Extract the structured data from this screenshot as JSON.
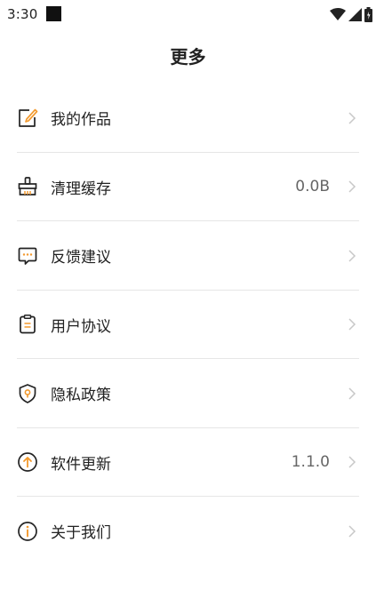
{
  "status_bar": {
    "time": "3:30",
    "icons": [
      "square-notification-icon",
      "wifi-icon",
      "signal-icon",
      "battery-icon"
    ]
  },
  "header": {
    "title": "更多"
  },
  "colors": {
    "accent": "#f39a2e",
    "text": "#222222",
    "secondary_text": "#666666",
    "divider": "#e6e6e6",
    "chevron": "#c8c8c8"
  },
  "menu": {
    "items": [
      {
        "label": "我的作品",
        "value": "",
        "icon": "edit-note-icon"
      },
      {
        "label": "清理缓存",
        "value": "0.0B",
        "icon": "broom-icon"
      },
      {
        "label": "反馈建议",
        "value": "",
        "icon": "chat-bubble-icon"
      },
      {
        "label": "用户协议",
        "value": "",
        "icon": "clipboard-icon"
      },
      {
        "label": "隐私政策",
        "value": "",
        "icon": "shield-icon"
      },
      {
        "label": "软件更新",
        "value": "1.1.0",
        "icon": "upload-arrow-icon"
      },
      {
        "label": "关于我们",
        "value": "",
        "icon": "info-icon"
      }
    ]
  }
}
